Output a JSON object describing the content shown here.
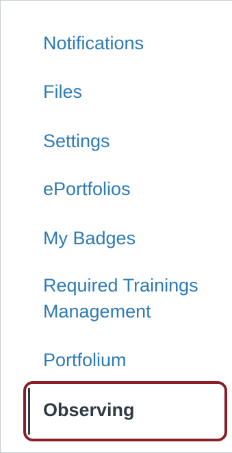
{
  "nav": {
    "items": [
      {
        "label": "Notifications"
      },
      {
        "label": "Files"
      },
      {
        "label": "Settings"
      },
      {
        "label": "ePortfolios"
      },
      {
        "label": "My Badges"
      },
      {
        "label": "Required Trainings Management"
      },
      {
        "label": "Portfolium"
      }
    ],
    "active": {
      "label": "Observing"
    }
  },
  "colors": {
    "link": "#2d7bb5",
    "active_text": "#2d3b45",
    "highlight_border": "#8b1d27"
  }
}
